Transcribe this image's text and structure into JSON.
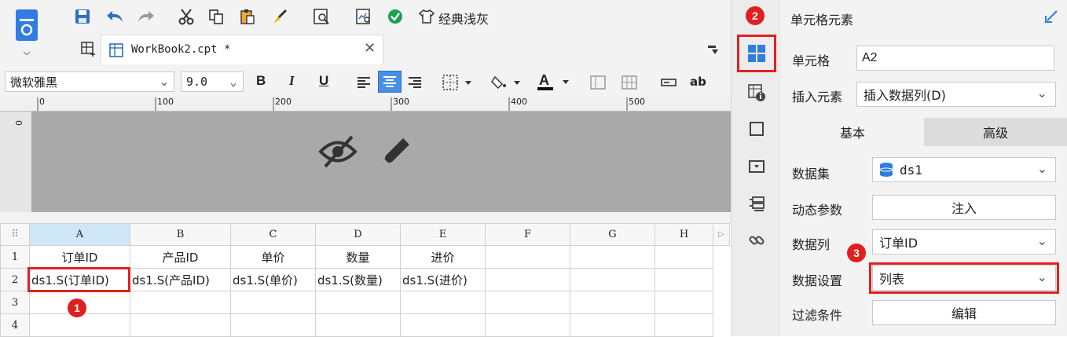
{
  "toolbar": {
    "theme_label": "经典浅灰"
  },
  "tab": {
    "title": "WorkBook2.cpt *"
  },
  "format": {
    "font_name": "微软雅黑",
    "font_size": "9.0",
    "bold": "B",
    "italic": "I",
    "underline": "U",
    "text_ab": "ab"
  },
  "ruler": {
    "ticks": [
      "0",
      "100",
      "200",
      "300",
      "400",
      "500"
    ],
    "v_tick": "0"
  },
  "sheet": {
    "columns": [
      "A",
      "B",
      "C",
      "D",
      "E",
      "F",
      "G",
      "H"
    ],
    "rows": [
      {
        "num": "1",
        "cells": [
          "订单ID",
          "产品ID",
          "单价",
          "数量",
          "进价",
          "",
          "",
          ""
        ]
      },
      {
        "num": "2",
        "cells": [
          "ds1.S(订单ID)",
          "ds1.S(产品ID)",
          "ds1.S(单价)",
          "ds1.S(数量)",
          "ds1.S(进价)",
          "",
          "",
          ""
        ]
      },
      {
        "num": "3",
        "cells": [
          "",
          "",
          "",
          "",
          "",
          "",
          "",
          ""
        ]
      },
      {
        "num": "4",
        "cells": [
          "",
          "",
          "",
          "",
          "",
          "",
          "",
          ""
        ]
      }
    ]
  },
  "badges": {
    "b1": "1",
    "b2": "2",
    "b3": "3"
  },
  "panel": {
    "title": "单元格元素",
    "cell_label": "单元格",
    "cell_value": "A2",
    "insert_label": "插入元素",
    "insert_value": "插入数据列(D)",
    "tab_basic": "基本",
    "tab_advanced": "高级",
    "dataset_label": "数据集",
    "dataset_value": "ds1",
    "dyn_param_label": "动态参数",
    "inject_button": "注入",
    "column_label": "数据列",
    "column_value": "订单ID",
    "data_setting_label": "数据设置",
    "data_setting_value": "列表",
    "filter_label": "过滤条件",
    "edit_button": "编辑"
  },
  "colors": {
    "accent": "#2f7de1",
    "highlight": "#e02020",
    "selected_header": "#cfe6f7"
  }
}
